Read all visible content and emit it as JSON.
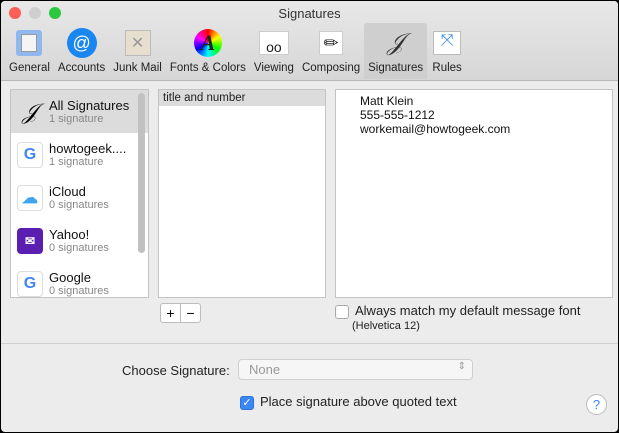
{
  "window": {
    "title": "Signatures"
  },
  "toolbar": [
    {
      "label": "General",
      "icon": "general-icon"
    },
    {
      "label": "Accounts",
      "icon": "at-icon"
    },
    {
      "label": "Junk Mail",
      "icon": "trash-icon"
    },
    {
      "label": "Fonts & Colors",
      "icon": "fonts-icon"
    },
    {
      "label": "Viewing",
      "icon": "glasses-icon"
    },
    {
      "label": "Composing",
      "icon": "pencil-icon"
    },
    {
      "label": "Signatures",
      "icon": "signature-icon"
    },
    {
      "label": "Rules",
      "icon": "rules-icon"
    }
  ],
  "accounts": [
    {
      "name": "All Signatures",
      "count": "1 signature"
    },
    {
      "name": "howtogeek....",
      "count": "1 signature"
    },
    {
      "name": "iCloud",
      "count": "0 signatures"
    },
    {
      "name": "Yahoo!",
      "count": "0 signatures"
    },
    {
      "name": "Google",
      "count": "0 signatures"
    }
  ],
  "signatures": [
    "title and number"
  ],
  "preview": {
    "lines": [
      "Matt Klein",
      "555-555-1212",
      "workemail@howtogeek.com"
    ]
  },
  "buttons": {
    "add": "+",
    "remove": "−",
    "help": "?"
  },
  "options": {
    "match_font": "Always match my default message font",
    "font_note": "(Helvetica 12)",
    "choose_label": "Choose Signature:",
    "choose_value": "None",
    "place_above": "Place signature above quoted text"
  }
}
